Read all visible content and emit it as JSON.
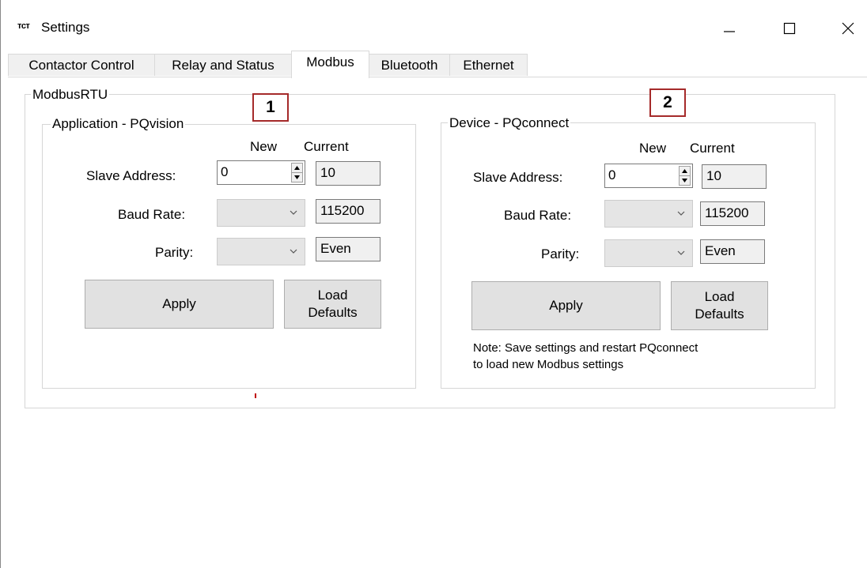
{
  "window": {
    "app_icon_text": "ᴛᴄᴛ",
    "title": "Settings",
    "minimize_icon": "minimize-icon",
    "maximize_icon": "maximize-icon",
    "close_icon": "close-icon"
  },
  "tabs": [
    {
      "label": "Contactor Control",
      "active": false
    },
    {
      "label": "Relay and Status",
      "active": false
    },
    {
      "label": "Modbus",
      "active": true
    },
    {
      "label": "Bluetooth",
      "active": false
    },
    {
      "label": "Ethernet",
      "active": false
    }
  ],
  "modbus_rtu": {
    "group_label": "ModbusRTU",
    "callouts": [
      "1",
      "2"
    ],
    "application": {
      "group_label": "Application - PQvision",
      "col_new": "New",
      "col_current": "Current",
      "slave_address_label": "Slave Address:",
      "slave_address_new": "0",
      "slave_address_current": "10",
      "baud_rate_label": "Baud Rate:",
      "baud_rate_new": "",
      "baud_rate_current": "115200",
      "parity_label": "Parity:",
      "parity_new": "",
      "parity_current": "Even",
      "apply_label": "Apply",
      "load_defaults_label": "Load Defaults"
    },
    "device": {
      "group_label": "Device - PQconnect",
      "col_new": "New",
      "col_current": "Current",
      "slave_address_label": "Slave Address:",
      "slave_address_new": "0",
      "slave_address_current": "10",
      "baud_rate_label": "Baud Rate:",
      "baud_rate_new": "",
      "baud_rate_current": "115200",
      "parity_label": "Parity:",
      "parity_new": "",
      "parity_current": "Even",
      "apply_label": "Apply",
      "load_defaults_label": "Load Defaults",
      "note_line1": "Note: Save settings and restart PQconnect",
      "note_line2": "to load new Modbus settings"
    }
  }
}
